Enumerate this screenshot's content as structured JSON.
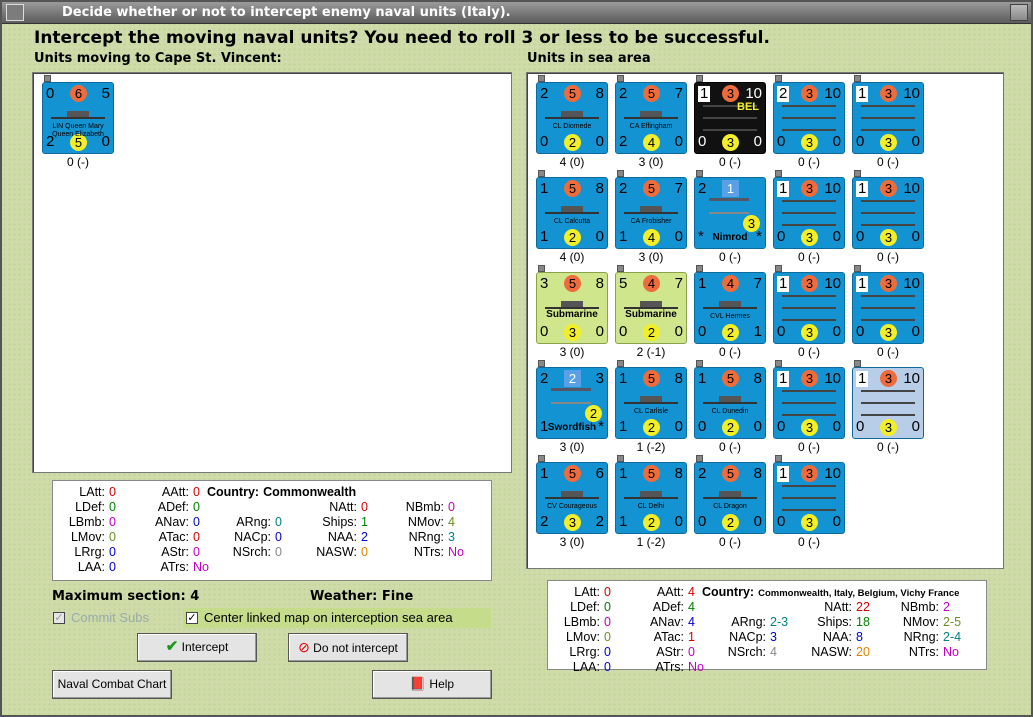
{
  "window": {
    "title": "Decide whether or not to intercept enemy naval units (Italy)."
  },
  "heading": "Intercept the moving naval units?  You need to roll 3 or less to be successful.",
  "left_label": "Units moving to Cape St. Vincent:",
  "right_label": "Units in sea area",
  "moving_units": [
    {
      "tl": "0",
      "tc": "6",
      "tr": "5",
      "name": "LIN Queen Mary\nQueen Elizabeth",
      "bl": "2",
      "bc": "5",
      "br": "0",
      "cap": "0 (-)"
    }
  ],
  "sea_units": [
    {
      "tl": "2",
      "tc": "5",
      "tr": "8",
      "name": "CL Diomede",
      "bl": "0",
      "bc": "2",
      "br": "0",
      "cap": "4 (0)"
    },
    {
      "tl": "2",
      "tc": "5",
      "tr": "7",
      "name": "CA Effingham",
      "bl": "2",
      "bc": "4",
      "br": "0",
      "cap": "3 (0)"
    },
    {
      "tl": "1",
      "tc": "3",
      "tr": "10",
      "name": "BEL",
      "bl": "0",
      "bc": "3",
      "br": "0",
      "cap": "0 (-)",
      "dark": true
    },
    {
      "tl": "2",
      "tc": "3",
      "tr": "10",
      "name": "",
      "bl": "0",
      "bc": "3",
      "br": "0",
      "cap": "0 (-)"
    },
    {
      "tl": "1",
      "tc": "3",
      "tr": "10",
      "name": "",
      "bl": "0",
      "bc": "3",
      "br": "0",
      "cap": "0 (-)"
    },
    {
      "tl": "1",
      "tc": "5",
      "tr": "8",
      "name": "CL Calcutta",
      "bl": "1",
      "bc": "2",
      "br": "0",
      "cap": "4 (0)"
    },
    {
      "tl": "2",
      "tc": "5",
      "tr": "7",
      "name": "CA Frobisher",
      "bl": "1",
      "bc": "4",
      "br": "0",
      "cap": "3 (0)"
    },
    {
      "tl": "2",
      "tc": "1",
      "tr": "",
      "name": "Nimrod",
      "bl": "*",
      "bc": "3",
      "br": "*",
      "cap": "0 (-)",
      "air": true
    },
    {
      "tl": "1",
      "tc": "3",
      "tr": "10",
      "name": "",
      "bl": "0",
      "bc": "3",
      "br": "0",
      "cap": "0 (-)"
    },
    {
      "tl": "1",
      "tc": "3",
      "tr": "10",
      "name": "",
      "bl": "0",
      "bc": "3",
      "br": "0",
      "cap": "0 (-)"
    },
    {
      "tl": "3",
      "tc": "5",
      "tr": "8",
      "name": "Submarine",
      "bl": "0",
      "bc": "3",
      "br": "0",
      "cap": "3 (0)",
      "sub": true
    },
    {
      "tl": "5",
      "tc": "4",
      "tr": "7",
      "name": "Submarine",
      "bl": "0",
      "bc": "2",
      "br": "0",
      "cap": "2 (-1)",
      "sub": true
    },
    {
      "tl": "1",
      "tc": "4",
      "tr": "7",
      "name": "CVL Hermes",
      "bl": "0",
      "bc": "2",
      "br": "1",
      "cap": "0 (-)"
    },
    {
      "tl": "1",
      "tc": "3",
      "tr": "10",
      "name": "",
      "bl": "0",
      "bc": "3",
      "br": "0",
      "cap": "0 (-)"
    },
    {
      "tl": "1",
      "tc": "3",
      "tr": "10",
      "name": "",
      "bl": "0",
      "bc": "3",
      "br": "0",
      "cap": "0 (-)",
      "white": true
    },
    {
      "tl": "2",
      "tc": "2",
      "tr": "3",
      "name": "Swordfish",
      "bl": "1",
      "bc": "2",
      "br": "*",
      "cap": "3 (0)",
      "air": true
    },
    {
      "tl": "1",
      "tc": "5",
      "tr": "8",
      "name": "CL Carlisle",
      "bl": "1",
      "bc": "2",
      "br": "0",
      "cap": "1 (-2)"
    },
    {
      "tl": "1",
      "tc": "5",
      "tr": "8",
      "name": "CL Dunedin",
      "bl": "0",
      "bc": "2",
      "br": "0",
      "cap": "0 (-)"
    },
    {
      "tl": "1",
      "tc": "3",
      "tr": "10",
      "name": "",
      "bl": "0",
      "bc": "3",
      "br": "0",
      "cap": "0 (-)"
    },
    {
      "tl": "1",
      "tc": "3",
      "tr": "10",
      "name": "",
      "bl": "0",
      "bc": "3",
      "br": "0",
      "cap": "0 (-)",
      "light": true
    },
    {
      "tl": "1",
      "tc": "5",
      "tr": "6",
      "name": "CV Courageous",
      "bl": "2",
      "bc": "3",
      "br": "2",
      "cap": "3 (0)"
    },
    {
      "tl": "1",
      "tc": "5",
      "tr": "8",
      "name": "CL Delhi",
      "bl": "1",
      "bc": "2",
      "br": "0",
      "cap": "1 (-2)"
    },
    {
      "tl": "2",
      "tc": "5",
      "tr": "8",
      "name": "CL Dragon",
      "bl": "0",
      "bc": "2",
      "br": "0",
      "cap": "0 (-)"
    },
    {
      "tl": "1",
      "tc": "3",
      "tr": "10",
      "name": "",
      "bl": "0",
      "bc": "3",
      "br": "0",
      "cap": "0 (-)"
    }
  ],
  "left_stats": {
    "country_label": "Country:",
    "country": "Commonwealth",
    "rows": [
      [
        "LAtt:",
        "0"
      ],
      [
        "LDef:",
        "0"
      ],
      [
        "LBmb:",
        "0"
      ],
      [
        "LMov:",
        "0"
      ],
      [
        "LRrg:",
        "0"
      ],
      [
        "LAA:",
        "0"
      ],
      [
        "AAtt:",
        "0"
      ],
      [
        "ADef:",
        "0"
      ],
      [
        "ANav:",
        "0"
      ],
      [
        "ATac:",
        "0"
      ],
      [
        "AStr:",
        "0"
      ],
      [
        "ATrs:",
        "No"
      ],
      [
        "ARng:",
        "0"
      ],
      [
        "NACp:",
        "0"
      ],
      [
        "NSrch:",
        "0"
      ],
      [
        "NAtt:",
        "0"
      ],
      [
        "Ships:",
        "1"
      ],
      [
        "NAA:",
        "2"
      ],
      [
        "NASW:",
        "0"
      ],
      [
        "NBmb:",
        "0"
      ],
      [
        "NMov:",
        "4"
      ],
      [
        "NRng:",
        "3"
      ],
      [
        "NTrs:",
        "No"
      ]
    ]
  },
  "right_stats": {
    "country_label": "Country:",
    "country": "Commonwealth, Italy, Belgium, Vichy France",
    "rows": [
      [
        "LAtt:",
        "0"
      ],
      [
        "LDef:",
        "0"
      ],
      [
        "LBmb:",
        "0"
      ],
      [
        "LMov:",
        "0"
      ],
      [
        "LRrg:",
        "0"
      ],
      [
        "LAA:",
        "0"
      ],
      [
        "AAtt:",
        "4"
      ],
      [
        "ADef:",
        "4"
      ],
      [
        "ANav:",
        "4"
      ],
      [
        "ATac:",
        "1"
      ],
      [
        "AStr:",
        "0"
      ],
      [
        "ATrs:",
        "No"
      ],
      [
        "ARng:",
        "2-3"
      ],
      [
        "NACp:",
        "3"
      ],
      [
        "NSrch:",
        "4"
      ],
      [
        "NAtt:",
        "22"
      ],
      [
        "Ships:",
        "18"
      ],
      [
        "NAA:",
        "8"
      ],
      [
        "NASW:",
        "20"
      ],
      [
        "NBmb:",
        "2"
      ],
      [
        "NMov:",
        "2-5"
      ],
      [
        "NRng:",
        "2-4"
      ],
      [
        "NTrs:",
        "No"
      ]
    ]
  },
  "max_section": "Maximum section: 4",
  "weather": "Weather:  Fine",
  "commit_subs": "Commit Subs",
  "center_map": "Center linked map on interception sea area",
  "buttons": {
    "intercept": "Intercept",
    "no_intercept": "Do not intercept",
    "chart": "Naval Combat Chart",
    "help": "Help"
  }
}
